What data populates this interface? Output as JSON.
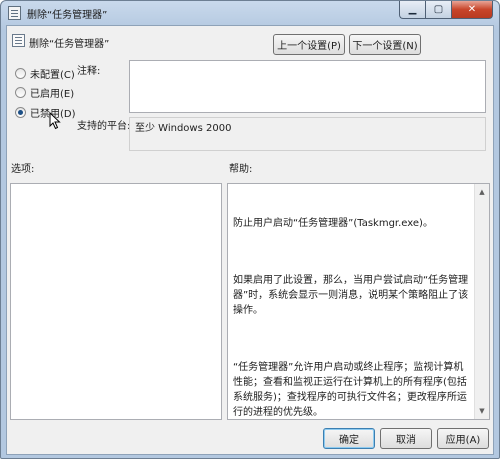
{
  "window": {
    "title": "删除“任务管理器”",
    "close_glyph": "✕",
    "min_glyph": "▁",
    "max_glyph": "▢"
  },
  "header": {
    "title": "删除“任务管理器”",
    "prev_button": "上一个设置(P)",
    "next_button": "下一个设置(N)"
  },
  "state": {
    "options": [
      {
        "label": "未配置(C)",
        "checked": false
      },
      {
        "label": "已启用(E)",
        "checked": false
      },
      {
        "label": "已禁用(D)",
        "checked": true
      }
    ]
  },
  "comment": {
    "label": "注释:",
    "value": ""
  },
  "platform": {
    "label": "支持的平台:",
    "value": "至少 Windows 2000"
  },
  "options_section": {
    "label": "选项:"
  },
  "help_section": {
    "label": "帮助:",
    "paragraphs": [
      "防止用户启动“任务管理器”(Taskmgr.exe)。",
      "如果启用了此设置，那么，当用户尝试启动“任务管理器”时，系统会显示一则消息，说明某个策略阻止了该操作。",
      "“任务管理器”允许用户启动或终止程序；监视计算机性能；查看和监视正运行在计算机上的所有程序(包括系统服务)；查找程序的可执行文件名；更改程序所运行的进程的优先级。"
    ]
  },
  "footer": {
    "ok_button": "确定",
    "cancel_button": "取消",
    "apply_button": "应用(A)"
  }
}
